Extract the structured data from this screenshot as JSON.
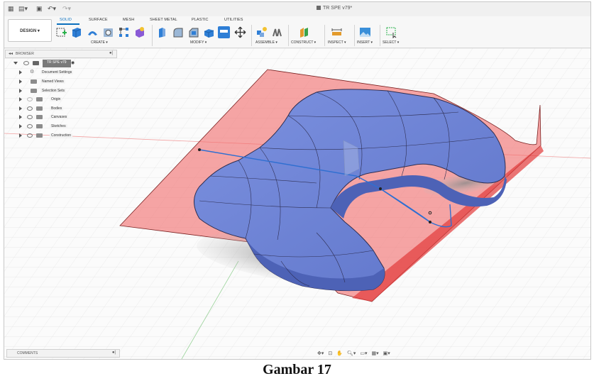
{
  "quick_access": {
    "grid_icon": "apps-grid-icon",
    "file_icon": "file-menu-icon",
    "save_icon": "save-icon",
    "undo_icon": "undo-icon",
    "redo_icon": "redo-icon"
  },
  "document": {
    "title": "TR SPE v79*"
  },
  "workspace": {
    "label": "DESIGN ▾"
  },
  "tabs": [
    {
      "label": "SOLID",
      "active": true
    },
    {
      "label": "SURFACE",
      "active": false
    },
    {
      "label": "MESH",
      "active": false
    },
    {
      "label": "SHEET METAL",
      "active": false
    },
    {
      "label": "PLASTIC",
      "active": false
    },
    {
      "label": "UTILITIES",
      "active": false
    }
  ],
  "groups": {
    "create": "CREATE ▾",
    "modify": "MODIFY ▾",
    "assemble": "ASSEMBLE ▾",
    "construct": "CONSTRUCT ▾",
    "inspect": "INSPECT ▾",
    "insert": "INSERT ▾",
    "select": "SELECT ▾"
  },
  "browser": {
    "header": "BROWSER",
    "root": "TR SPE v79",
    "nodes": [
      {
        "label": "Document Settings"
      },
      {
        "label": "Named Views"
      },
      {
        "label": "Selection Sets"
      },
      {
        "label": "Origin"
      },
      {
        "label": "Bodies"
      },
      {
        "label": "Canvases"
      },
      {
        "label": "Sketches"
      },
      {
        "label": "Construction"
      }
    ]
  },
  "comments": {
    "header": "COMMENTS"
  },
  "caption": "Gambar 17",
  "colors": {
    "accent": "#0b6fbd",
    "body_blue": "#6f86d8",
    "surface_red": "#f26a6a",
    "sketch_line": "#2f6fd1"
  }
}
